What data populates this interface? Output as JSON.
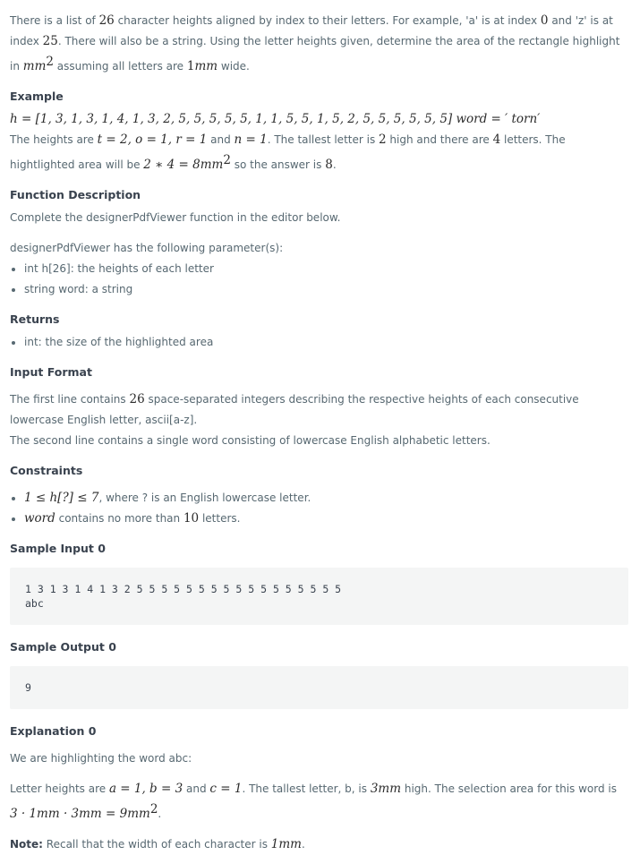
{
  "intro": {
    "t1": "There is a list of ",
    "n26": "26",
    "t2": " character heights aligned by index to their letters. For example, 'a' is at index ",
    "n0": "0",
    "t3": " and 'z' is at index ",
    "n25": "25",
    "t4": ". There will also be a string. Using the letter heights given, determine the area of the rectangle highlight in ",
    "mm": "mm",
    "sq": "2",
    "t5": " assuming all letters are ",
    "one": "1",
    "mm2": "mm",
    "t6": " wide."
  },
  "example": {
    "heading": "Example",
    "h_formula": "h = [1, 3, 1, 3, 1, 4, 1, 3, 2, 5, 5, 5, 5, 5, 1, 1, 5, 5, 1, 5, 2, 5, 5, 5, 5, 5, 5]",
    "word_formula": " word = ′ torn′",
    "p1_a": "The heights are ",
    "p1_m": "t = 2, o = 1, r = 1",
    "p1_b": " and ",
    "p1_m2": "n = 1",
    "p1_c": ". The tallest letter is ",
    "p1_2": "2",
    "p1_d": " high and there are ",
    "p1_4": "4",
    "p1_e": " letters. The hightlighted area will be ",
    "p1_m3": "2 ∗ 4 = 8mm",
    "p1_sq": "2",
    "p1_f": " so the answer is ",
    "p1_8": "8",
    "p1_g": "."
  },
  "function_description": {
    "heading": "Function Description",
    "p1": "Complete the designerPdfViewer function in the editor below.",
    "p2": "designerPdfViewer has the following parameter(s):",
    "params": [
      "int h[26]: the heights of each letter",
      "string word: a string"
    ]
  },
  "returns": {
    "heading": "Returns",
    "items": [
      "int: the size of the highlighted area"
    ]
  },
  "input_format": {
    "heading": "Input Format",
    "l1_a": "The first line contains ",
    "l1_n": "26",
    "l1_b": " space-separated integers describing the respective heights of each consecutive lowercase English letter, ascii[a-z].",
    "l2": "The second line contains a single word consisting of lowercase English alphabetic letters."
  },
  "constraints": {
    "heading": "Constraints",
    "c1_m": "1 ≤ h[?] ≤ 7",
    "c1_t": ", where ? is an English lowercase letter.",
    "c2_m": "word",
    "c2_t": " contains no more than ",
    "c2_n": "10",
    "c2_e": " letters."
  },
  "sample_input": {
    "heading": "Sample Input 0",
    "code": "1 3 1 3 1 4 1 3 2 5 5 5 5 5 5 5 5 5 5 5 5 5 5 5 5 5\nabc"
  },
  "sample_output": {
    "heading": "Sample Output 0",
    "code": "9"
  },
  "explanation": {
    "heading": "Explanation 0",
    "p1": "We are highlighting the word abc:",
    "p2_a": "Letter heights are ",
    "p2_m": "a = 1, b = 3",
    "p2_b": " and ",
    "p2_m2": "c = 1",
    "p2_c": ". The tallest letter, b, is ",
    "p2_m3": "3mm",
    "p2_d": " high. The selection area for this word is",
    "p3_m": "3 · 1mm · 3mm = 9mm",
    "p3_sq": "2",
    "p3_e": ".",
    "note_label": "Note:",
    "note_text": " Recall that the width of each character is ",
    "note_m": "1mm",
    "note_e": "."
  }
}
